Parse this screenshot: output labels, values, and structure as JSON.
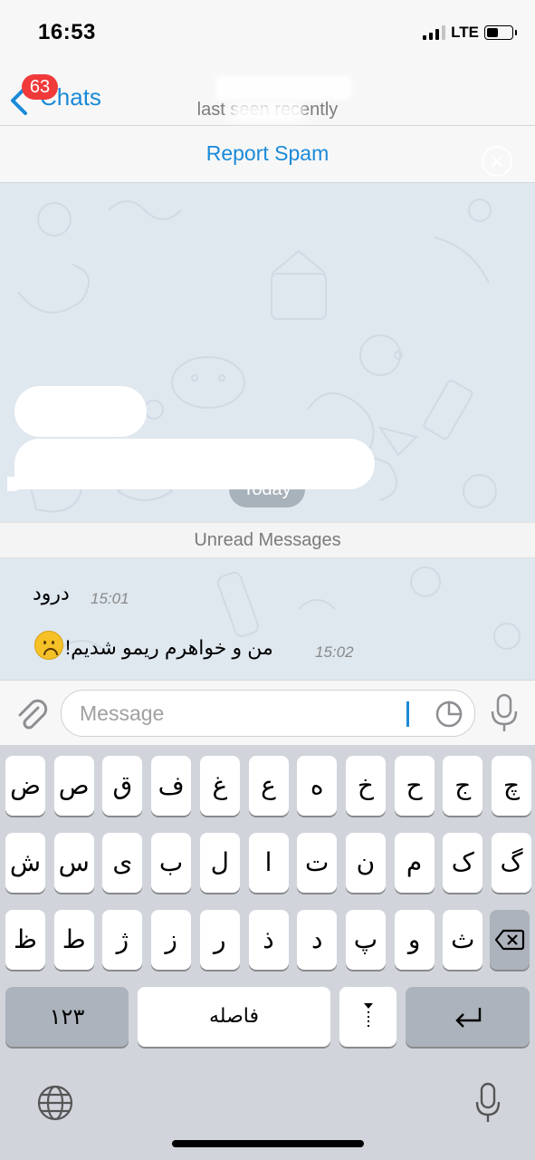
{
  "status_bar": {
    "time": "16:53",
    "network": "LTE",
    "signal_bars": 3,
    "battery_level": 0.45
  },
  "nav": {
    "back_label": "Chats",
    "unread_badge": "63",
    "subtitle": "last seen recently"
  },
  "report_bar": {
    "label": "Report Spam"
  },
  "chat": {
    "date_separator": "Today",
    "unread_divider": "Unread Messages",
    "messages": [
      {
        "text": "درود",
        "time": "15:01"
      },
      {
        "text": "من و خواهرم ریمو شدیم!",
        "time": "15:02",
        "emoji": "frowning-face"
      }
    ]
  },
  "composer": {
    "placeholder": "Message"
  },
  "keyboard": {
    "row1": [
      "ض",
      "ص",
      "ق",
      "ف",
      "غ",
      "ع",
      "ه",
      "خ",
      "ح",
      "ج",
      "چ"
    ],
    "row2": [
      "ش",
      "س",
      "ی",
      "ب",
      "ل",
      "ا",
      "ت",
      "ن",
      "م",
      "ک",
      "گ"
    ],
    "row3": [
      "ظ",
      "ط",
      "ژ",
      "ز",
      "ر",
      "ذ",
      "د",
      "پ",
      "و",
      "ث"
    ],
    "numbers_key": "۱۲۳",
    "space_key": "فاصله",
    "punctuation_key": "،",
    "return_key": "return"
  },
  "colors": {
    "accent": "#1a8ad8",
    "badge": "#f03a3a",
    "chat_bg": "#dfe7ef"
  }
}
